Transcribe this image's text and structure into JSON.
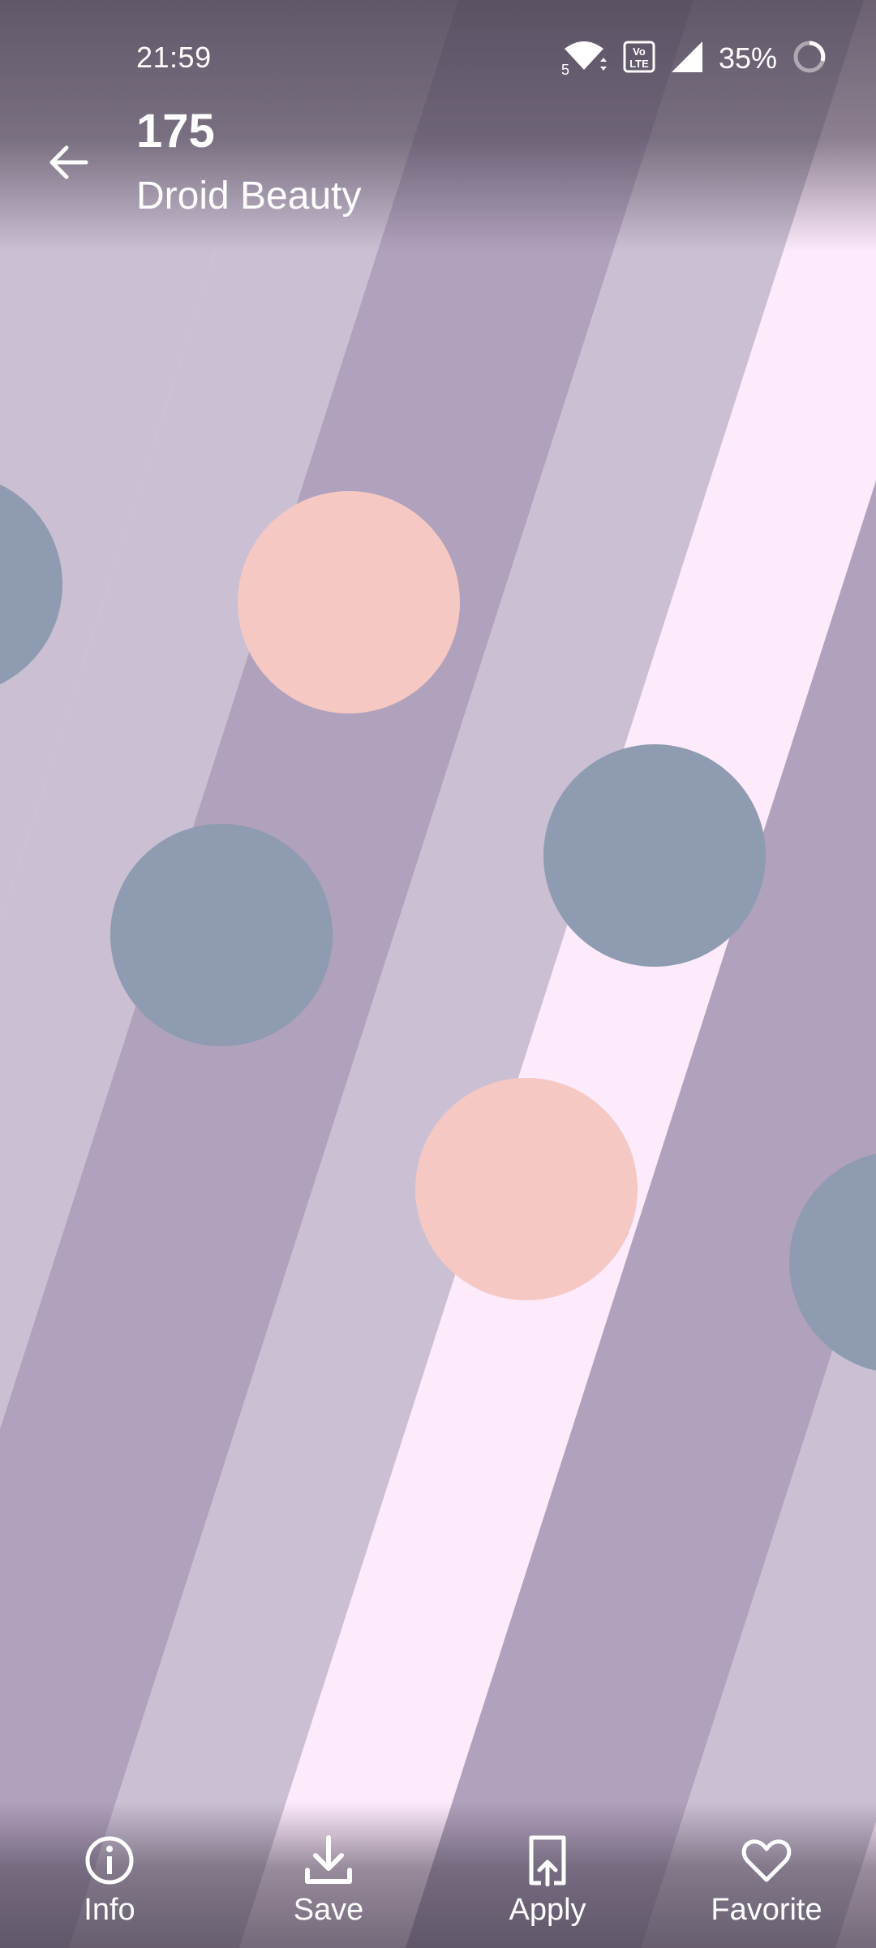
{
  "status_bar": {
    "time": "21:59",
    "battery_percent": "35%",
    "network_badge": "5",
    "volte_badge": "Vo LTE",
    "icons": [
      "wifi-icon",
      "volte-icon",
      "signal-icon",
      "battery-icon"
    ]
  },
  "app_bar": {
    "title": "175",
    "subtitle": "Droid Beauty",
    "back_icon": "arrow-left-icon"
  },
  "actions": [
    {
      "label": "Info",
      "icon": "info-icon"
    },
    {
      "label": "Save",
      "icon": "download-icon"
    },
    {
      "label": "Apply",
      "icon": "apply-icon"
    },
    {
      "label": "Favorite",
      "icon": "heart-icon"
    }
  ],
  "colors": {
    "background": "#fdeafb",
    "band_light": "#cbbfd3",
    "band_dark": "#b0a1bc",
    "circle_peach": "#f5c8c3",
    "circle_slate": "#8e9bb0",
    "icon_text": "#ffffff"
  }
}
